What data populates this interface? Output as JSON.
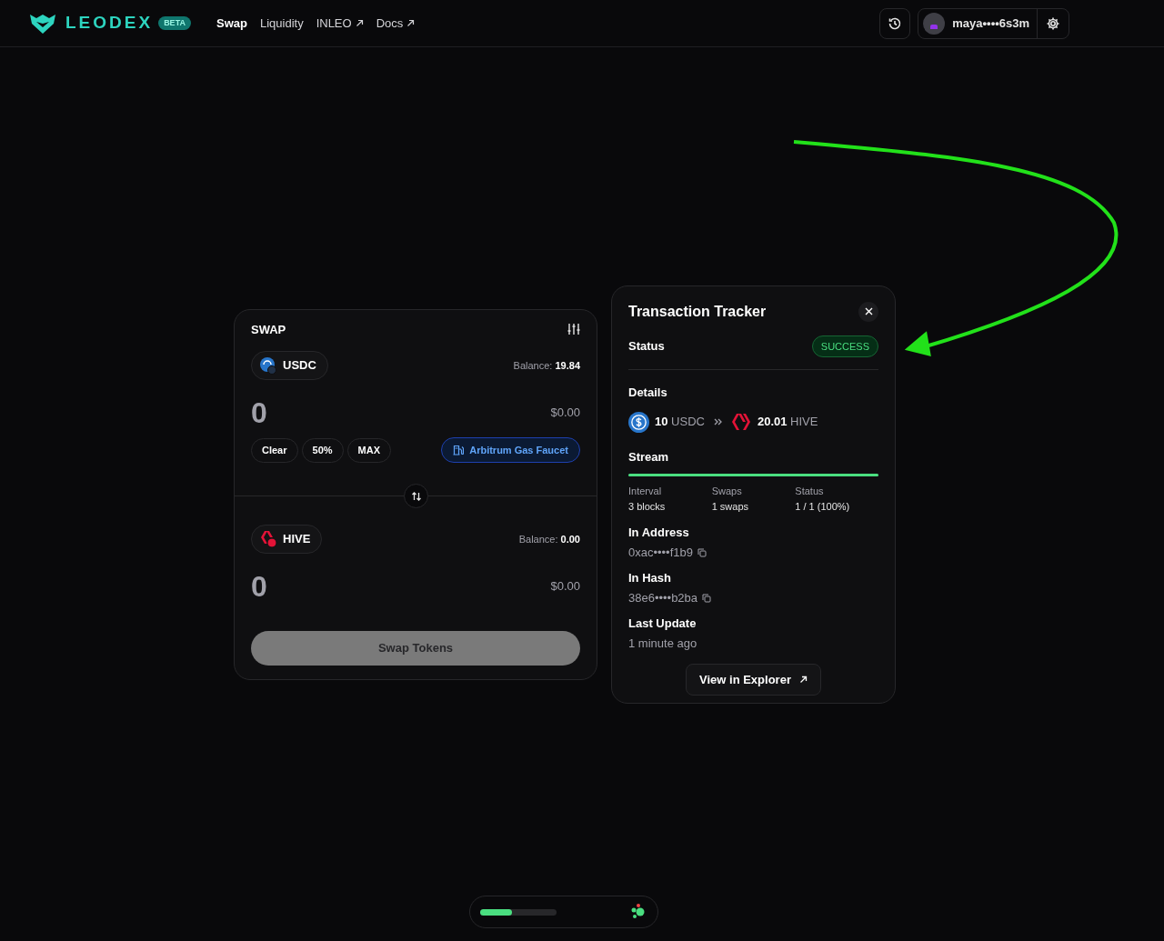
{
  "header": {
    "logo_text": "LEODEX",
    "badge": "BETA",
    "nav": [
      {
        "label": "Swap",
        "selected": true,
        "external": false
      },
      {
        "label": "Liquidity",
        "selected": false,
        "external": false
      },
      {
        "label": "INLEO",
        "selected": false,
        "external": true
      },
      {
        "label": "Docs",
        "selected": false,
        "external": true
      }
    ],
    "account": "maya••••6s3m"
  },
  "swap": {
    "title": "SWAP",
    "from": {
      "token": "USDC",
      "balance_label": "Balance:",
      "balance": "19.84",
      "amount": "0",
      "usd": "$0.00"
    },
    "quick": [
      "Clear",
      "50%",
      "MAX"
    ],
    "faucet": "Arbitrum Gas Faucet",
    "to": {
      "token": "HIVE",
      "balance_label": "Balance:",
      "balance": "0.00",
      "amount": "0",
      "usd": "$0.00"
    },
    "submit": {
      "label": "Swap Tokens",
      "disabled": true
    }
  },
  "tracker": {
    "title": "Transaction Tracker",
    "status_label": "Status",
    "status": "SUCCESS",
    "details_label": "Details",
    "from_amount": "10",
    "from_token": "USDC",
    "to_amount": "20.01",
    "to_token": "HIVE",
    "stream_label": "Stream",
    "stream_progress": {
      "level": 1
    },
    "stats": [
      {
        "label": "Interval",
        "value": "3 blocks"
      },
      {
        "label": "Swaps",
        "value": "1 swaps"
      },
      {
        "label": "Status",
        "value": "1 / 1 (100%)"
      }
    ],
    "fields": [
      {
        "label": "In Address",
        "value": "0xac••••f1b9",
        "kind": "copy"
      },
      {
        "label": "In Hash",
        "value": "38e6••••b2ba",
        "kind": "copy"
      },
      {
        "label": "Last Update",
        "value": "1 minute ago",
        "kind": "plain"
      }
    ],
    "explorer": "View in Explorer"
  },
  "footer_progress": {
    "level": 0.42
  }
}
